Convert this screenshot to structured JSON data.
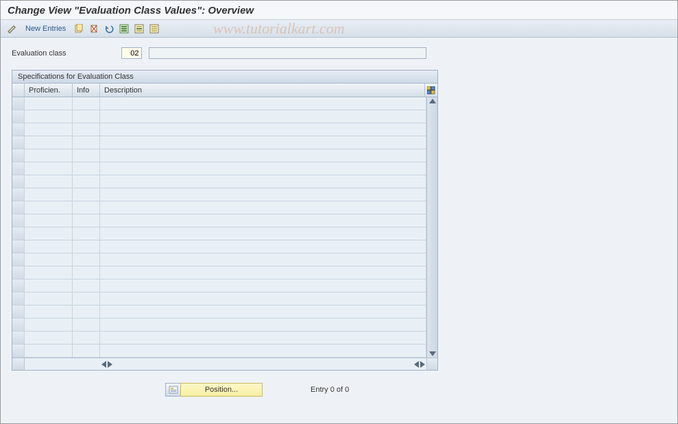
{
  "title": "Change View \"Evaluation Class Values\": Overview",
  "toolbar": {
    "new_entries_label": "New Entries"
  },
  "watermark": "www.tutorialkart.com",
  "form": {
    "eval_class_label": "Evaluation class",
    "eval_class_value": "02",
    "eval_class_desc": ""
  },
  "table": {
    "panel_title": "Specifications for Evaluation Class",
    "columns": {
      "proficiency": "Proficien.",
      "info": "Info",
      "description": "Description"
    },
    "rows": [
      {
        "proficiency": "",
        "info": "",
        "description": ""
      },
      {
        "proficiency": "",
        "info": "",
        "description": ""
      },
      {
        "proficiency": "",
        "info": "",
        "description": ""
      },
      {
        "proficiency": "",
        "info": "",
        "description": ""
      },
      {
        "proficiency": "",
        "info": "",
        "description": ""
      },
      {
        "proficiency": "",
        "info": "",
        "description": ""
      },
      {
        "proficiency": "",
        "info": "",
        "description": ""
      },
      {
        "proficiency": "",
        "info": "",
        "description": ""
      },
      {
        "proficiency": "",
        "info": "",
        "description": ""
      },
      {
        "proficiency": "",
        "info": "",
        "description": ""
      },
      {
        "proficiency": "",
        "info": "",
        "description": ""
      },
      {
        "proficiency": "",
        "info": "",
        "description": ""
      },
      {
        "proficiency": "",
        "info": "",
        "description": ""
      },
      {
        "proficiency": "",
        "info": "",
        "description": ""
      },
      {
        "proficiency": "",
        "info": "",
        "description": ""
      },
      {
        "proficiency": "",
        "info": "",
        "description": ""
      },
      {
        "proficiency": "",
        "info": "",
        "description": ""
      },
      {
        "proficiency": "",
        "info": "",
        "description": ""
      },
      {
        "proficiency": "",
        "info": "",
        "description": ""
      },
      {
        "proficiency": "",
        "info": "",
        "description": ""
      }
    ]
  },
  "footer": {
    "position_label": "Position...",
    "entry_text": "Entry 0 of 0"
  }
}
